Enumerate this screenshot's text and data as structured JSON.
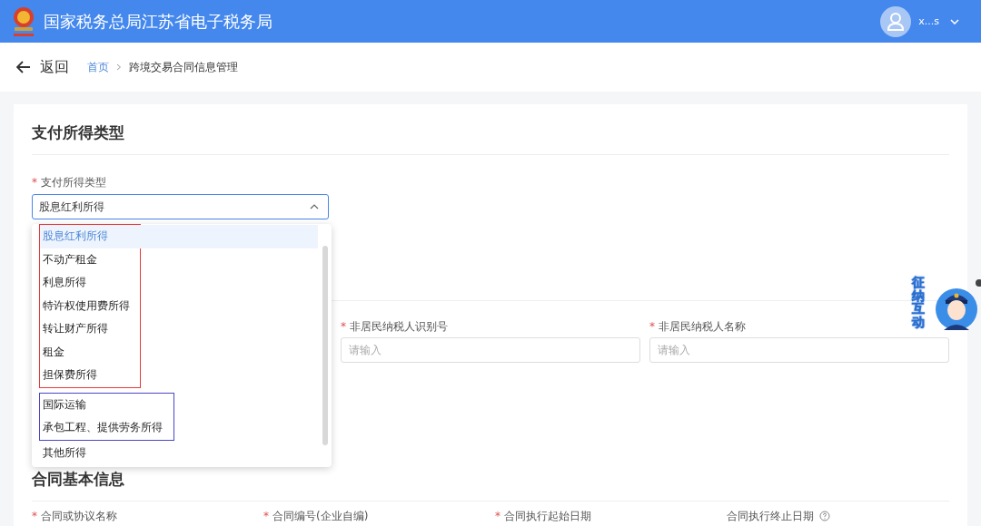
{
  "header": {
    "title": "国家税务总局江苏省电子税务局",
    "user": "x...s"
  },
  "breadcrumb": {
    "back": "返回",
    "items": [
      {
        "label": "首页",
        "link": true
      },
      {
        "label": "跨境交易合同信息管理",
        "link": false
      }
    ]
  },
  "section_1": {
    "title": "支付所得类型",
    "field": {
      "label": "支付所得类型",
      "required_mark": "*",
      "value": "股息红利所得",
      "open": true
    }
  },
  "dropdown": {
    "groups": [
      {
        "color": "#e53935",
        "options": [
          {
            "label": "股息红利所得",
            "selected": true
          },
          {
            "label": "不动产租金",
            "selected": false
          },
          {
            "label": "利息所得",
            "selected": false
          },
          {
            "label": "特许权使用费所得",
            "selected": false
          },
          {
            "label": "转让财产所得",
            "selected": false
          },
          {
            "label": "租金",
            "selected": false
          },
          {
            "label": "担保费所得",
            "selected": false
          }
        ]
      },
      {
        "color": "#4a46c8",
        "options": [
          {
            "label": "国际运输",
            "selected": false
          },
          {
            "label": "承包工程、提供劳务所得",
            "selected": false
          }
        ]
      },
      {
        "options": [
          {
            "label": "其他所得",
            "selected": false
          }
        ]
      }
    ]
  },
  "section_2": {
    "fields": [
      {
        "label": "非居民纳税人识别号",
        "required_mark": "*",
        "placeholder": "请输入"
      },
      {
        "label": "非居民纳税人名称",
        "required_mark": "*",
        "placeholder": "请输入"
      }
    ]
  },
  "section_3": {
    "title": "合同基本信息",
    "fields": [
      {
        "label": "合同或协议名称",
        "required_mark": "*"
      },
      {
        "label": "合同编号(企业自编)",
        "required_mark": "*"
      },
      {
        "label": "合同执行起始日期",
        "required_mark": "*"
      },
      {
        "label": "合同执行终止日期",
        "help": true
      }
    ]
  },
  "assistant_badge": {
    "label": "征纳互动"
  }
}
